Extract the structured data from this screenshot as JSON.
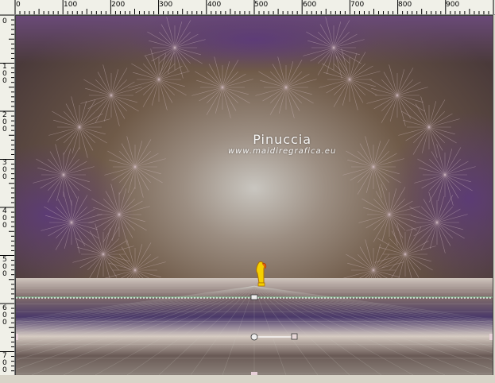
{
  "ruler_top": {
    "labels": [
      "0",
      "100",
      "200",
      "300",
      "400",
      "500",
      "600",
      "700",
      "800",
      "900"
    ]
  },
  "ruler_left": {
    "labels": [
      "0",
      "100",
      "200",
      "300",
      "400",
      "500",
      "600",
      "700"
    ]
  },
  "watermark": {
    "title": "Pinuccia",
    "url": "www.maidiregrafica.eu"
  },
  "colors": {
    "ruler_bg": "#f0f0e8",
    "canvas_border": "#404040",
    "guide_line": "#7ee0a0"
  },
  "icons": {
    "pointer": "pointing-hand-icon",
    "anchor": "pick-handle-icon"
  }
}
